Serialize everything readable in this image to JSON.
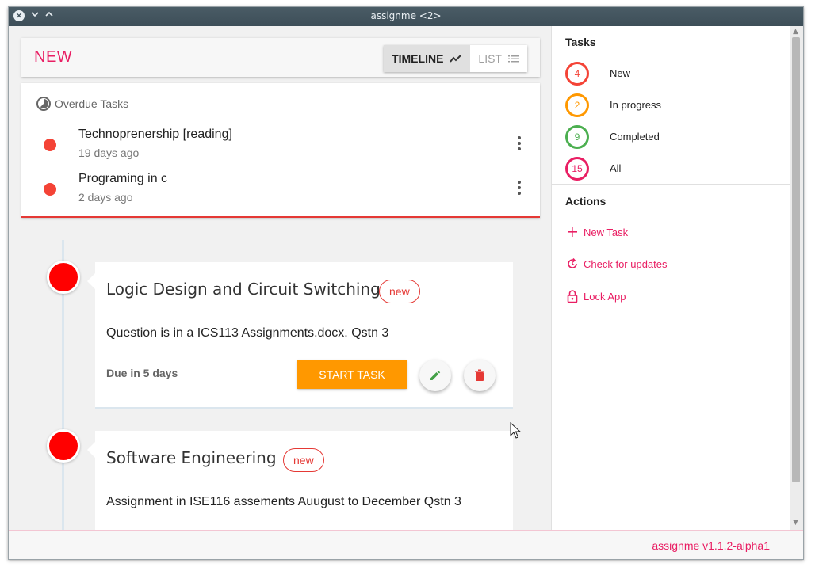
{
  "window": {
    "title": "assignme <2>"
  },
  "header": {
    "title": "NEW",
    "view_timeline": "TIMELINE",
    "view_list": "LIST"
  },
  "overdue": {
    "heading": "Overdue Tasks",
    "items": [
      {
        "title": "Technoprenership [reading]",
        "ago": "19 days ago"
      },
      {
        "title": "Programing in c",
        "ago": "2 days ago"
      }
    ]
  },
  "tasks": [
    {
      "title": "Logic Design and Circuit Switching",
      "status": "new",
      "description": "Question is in a ICS113 Assignments.docx. Qstn 3",
      "due": "Due in 5 days",
      "start_label": "START TASK"
    },
    {
      "title": "Software Engineering",
      "status": "new",
      "description": "Assignment in ISE116 assements Auugust to December Qstn 3"
    }
  ],
  "sidebar": {
    "tasks_heading": "Tasks",
    "stats": [
      {
        "count": "4",
        "label": "New",
        "color": "#f44336"
      },
      {
        "count": "2",
        "label": "In progress",
        "color": "#ff9800"
      },
      {
        "count": "9",
        "label": "Completed",
        "color": "#4caf50"
      },
      {
        "count": "15",
        "label": "All",
        "color": "#e91e63"
      }
    ],
    "actions_heading": "Actions",
    "actions": [
      {
        "label": "New Task",
        "icon": "plus-icon"
      },
      {
        "label": "Check for updates",
        "icon": "refresh-icon"
      },
      {
        "label": "Lock App",
        "icon": "lock-icon"
      }
    ]
  },
  "footer": {
    "version": "assignme v1.1.2-alpha1"
  },
  "colors": {
    "accent": "#e91e63",
    "overdue": "#f44336",
    "start": "#ff9800"
  }
}
